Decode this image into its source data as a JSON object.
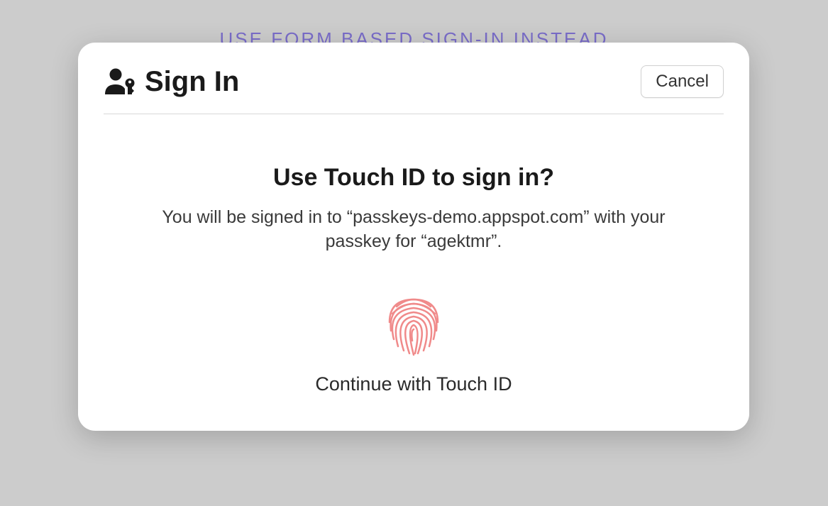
{
  "background": {
    "form_link_text": "USE FORM BASED SIGN-IN INSTEAD"
  },
  "dialog": {
    "title": "Sign In",
    "cancel_label": "Cancel",
    "prompt_heading": "Use Touch ID to sign in?",
    "prompt_description": "You will be signed in to “passkeys-demo.appspot.com” with your passkey for “agektmr”.",
    "continue_label": "Continue with Touch ID"
  },
  "colors": {
    "link": "#7a6dc9",
    "fingerprint": "#f08a8a"
  }
}
